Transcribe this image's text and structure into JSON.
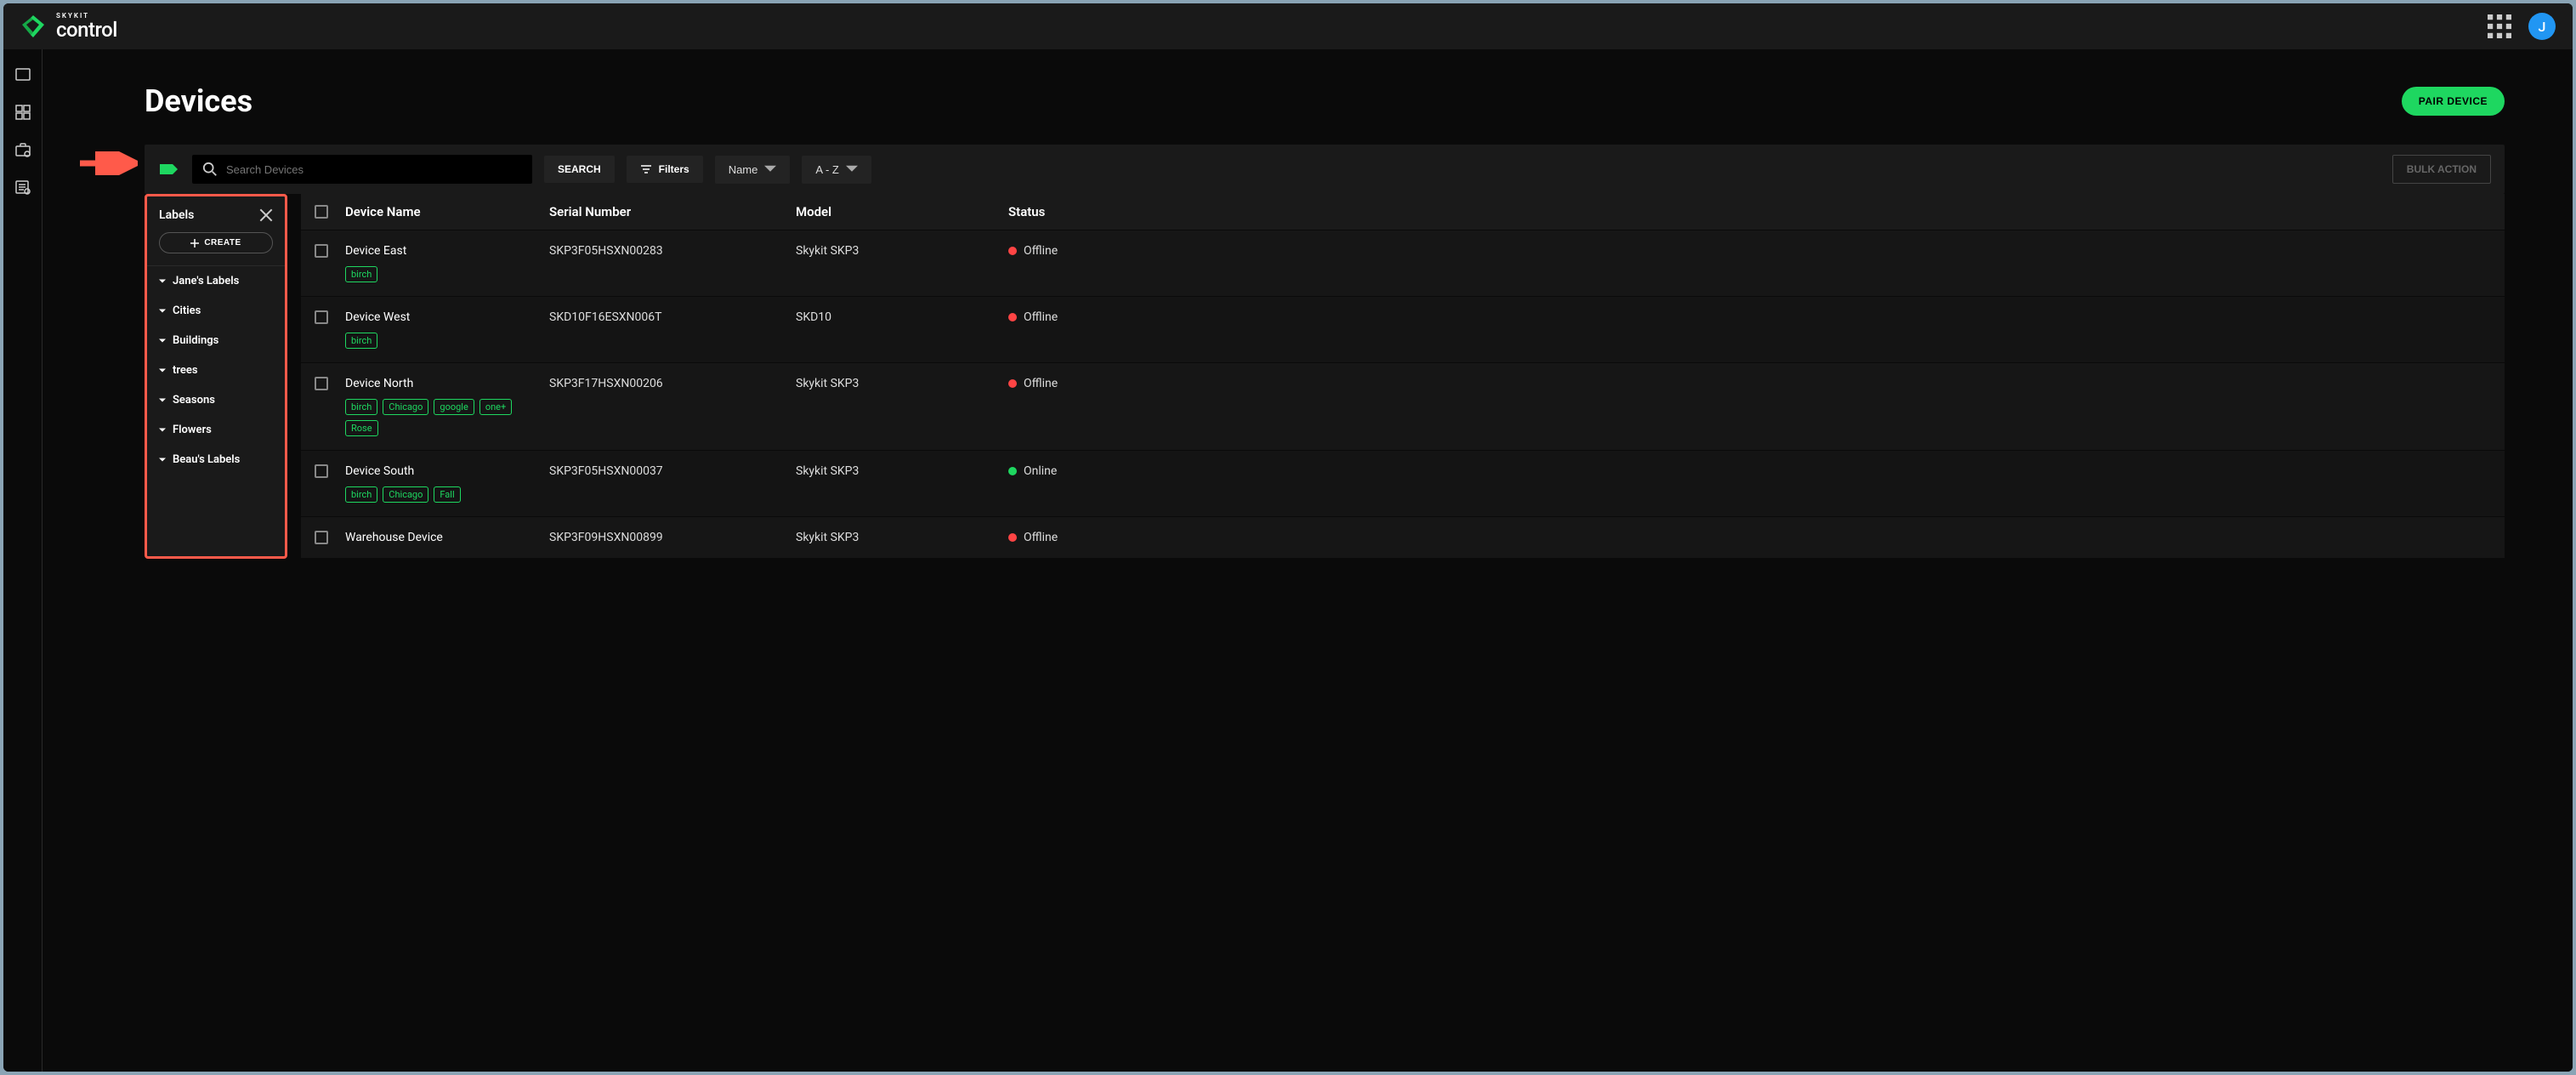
{
  "brand": {
    "name": "SKYKIT",
    "product": "control"
  },
  "avatar": {
    "initial": "J"
  },
  "page": {
    "title": "Devices",
    "pair_button": "PAIR DEVICE"
  },
  "toolbar": {
    "search_placeholder": "Search Devices",
    "search_button": "SEARCH",
    "filters_label": "Filters",
    "sort_field": "Name",
    "sort_order": "A - Z",
    "bulk_action": "BULK ACTION"
  },
  "labels_panel": {
    "title": "Labels",
    "create_label": "CREATE",
    "groups": [
      "Jane's Labels",
      "Cities",
      "Buildings",
      "trees",
      "Seasons",
      "Flowers",
      "Beau's Labels"
    ]
  },
  "table": {
    "columns": {
      "name": "Device Name",
      "serial": "Serial Number",
      "model": "Model",
      "status": "Status"
    },
    "rows": [
      {
        "name": "Device East",
        "serial": "SKP3F05HSXN00283",
        "model": "Skykit SKP3",
        "status": "Offline",
        "status_class": "offline",
        "tags": [
          "birch"
        ]
      },
      {
        "name": "Device West",
        "serial": "SKD10F16ESXN006T",
        "model": "SKD10",
        "status": "Offline",
        "status_class": "offline",
        "tags": [
          "birch"
        ]
      },
      {
        "name": "Device North",
        "serial": "SKP3F17HSXN00206",
        "model": "Skykit SKP3",
        "status": "Offline",
        "status_class": "offline",
        "tags": [
          "birch",
          "Chicago",
          "google",
          "one+",
          "Rose"
        ]
      },
      {
        "name": "Device South",
        "serial": "SKP3F05HSXN00037",
        "model": "Skykit SKP3",
        "status": "Online",
        "status_class": "online",
        "tags": [
          "birch",
          "Chicago",
          "Fall"
        ]
      },
      {
        "name": "Warehouse Device",
        "serial": "SKP3F09HSXN00899",
        "model": "Skykit SKP3",
        "status": "Offline",
        "status_class": "offline",
        "tags": []
      }
    ]
  }
}
